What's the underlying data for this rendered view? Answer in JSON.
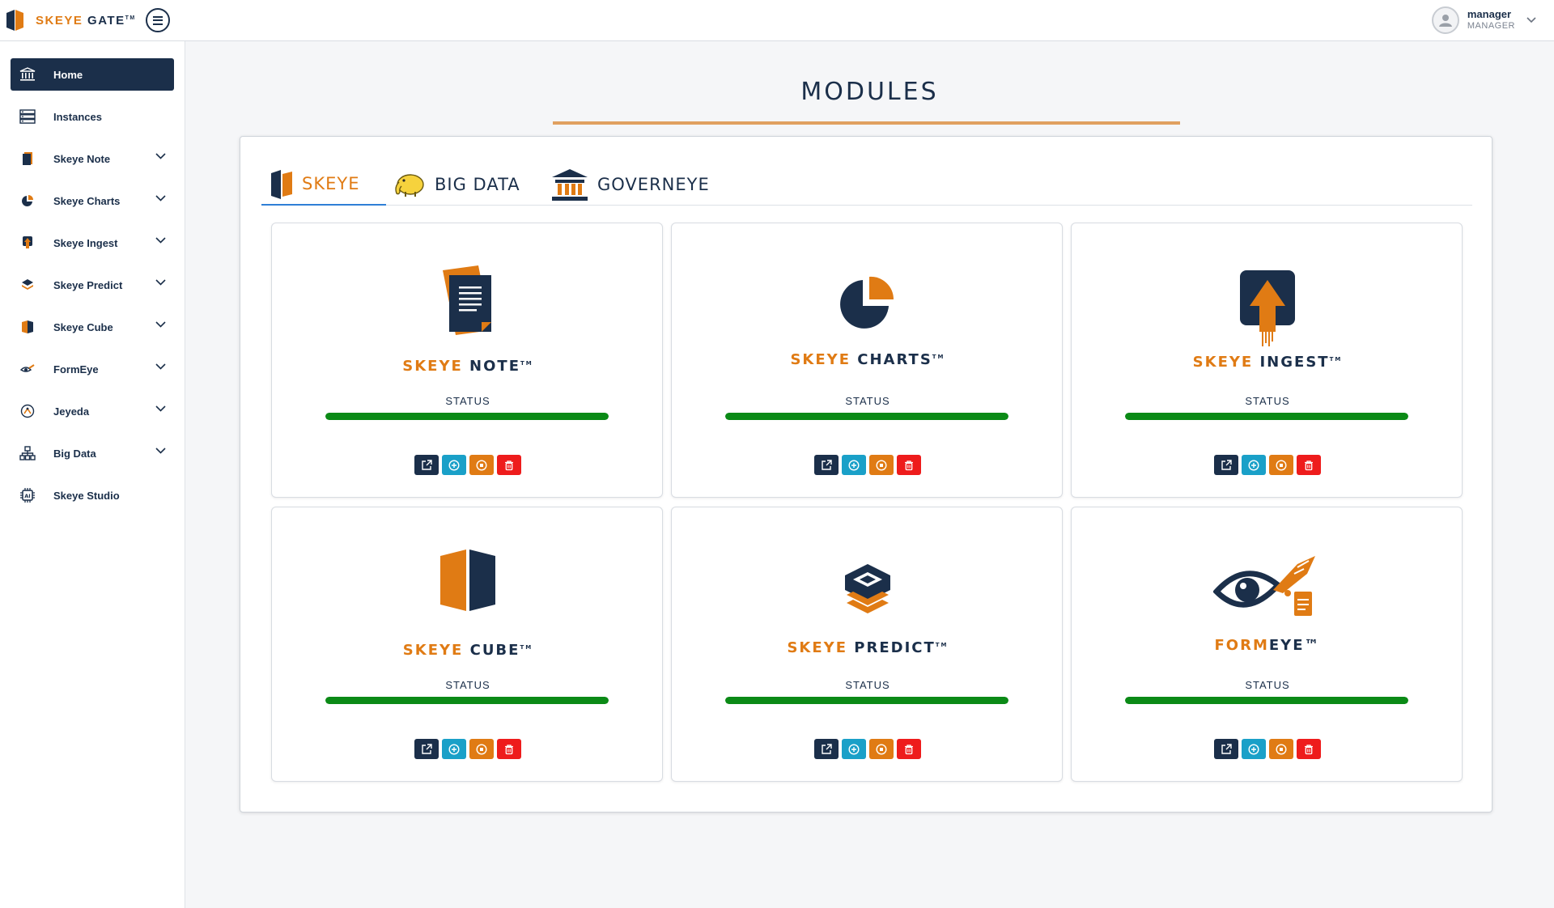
{
  "brand": {
    "name_orange": "SKEYE",
    "name_dark": " GATE",
    "tm": "TM"
  },
  "user": {
    "name": "manager",
    "role": "MANAGER"
  },
  "sidebar": {
    "items": [
      {
        "label": "Home",
        "icon": "bank-icon",
        "active": true,
        "expandable": false
      },
      {
        "label": "Instances",
        "icon": "server-icon",
        "active": false,
        "expandable": false
      },
      {
        "label": "Skeye Note",
        "icon": "note-icon",
        "active": false,
        "expandable": true
      },
      {
        "label": "Skeye Charts",
        "icon": "pie-chart-icon",
        "active": false,
        "expandable": true
      },
      {
        "label": "Skeye Ingest",
        "icon": "ingest-icon",
        "active": false,
        "expandable": true
      },
      {
        "label": "Skeye Predict",
        "icon": "predict-icon",
        "active": false,
        "expandable": true
      },
      {
        "label": "Skeye Cube",
        "icon": "cube-icon",
        "active": false,
        "expandable": true
      },
      {
        "label": "FormEye",
        "icon": "formeye-icon",
        "active": false,
        "expandable": true
      },
      {
        "label": "Jeyeda",
        "icon": "jeyeda-icon",
        "active": false,
        "expandable": true
      },
      {
        "label": "Big Data",
        "icon": "network-icon",
        "active": false,
        "expandable": true
      },
      {
        "label": "Skeye Studio",
        "icon": "ai-chip-icon",
        "active": false,
        "expandable": false
      }
    ]
  },
  "main": {
    "title": "MODULES",
    "tabs": [
      {
        "label": "SKEYE",
        "active": true
      },
      {
        "label": "BIG DATA",
        "active": false
      },
      {
        "label": "GOVERNEYE",
        "active": false
      }
    ],
    "cards": [
      {
        "name_orange": "SKEYE",
        "name_dark": " NOTE",
        "tm": "TM",
        "status_label": "STATUS",
        "status": 100
      },
      {
        "name_orange": "SKEYE",
        "name_dark": " CHARTS",
        "tm": "TM",
        "status_label": "STATUS",
        "status": 100
      },
      {
        "name_orange": "SKEYE",
        "name_dark": " INGEST",
        "tm": "TM",
        "status_label": "STATUS",
        "status": 100
      },
      {
        "name_orange": "SKEYE",
        "name_dark": " CUBE",
        "tm": "TM",
        "status_label": "STATUS",
        "status": 100
      },
      {
        "name_orange": "SKEYE",
        "name_dark": " PREDICT",
        "tm": "TM",
        "status_label": "STATUS",
        "status": 100
      },
      {
        "name_orange": "FORM",
        "name_dark": "EYE",
        "tm": "™",
        "status_label": "STATUS",
        "status": 100
      }
    ]
  },
  "colors": {
    "navy": "#1b2f4a",
    "orange": "#e07b14",
    "teal": "#1aa0c8",
    "red": "#ee1c1c",
    "green": "#0b8a16",
    "tab_underline": "#2f7fd6"
  }
}
